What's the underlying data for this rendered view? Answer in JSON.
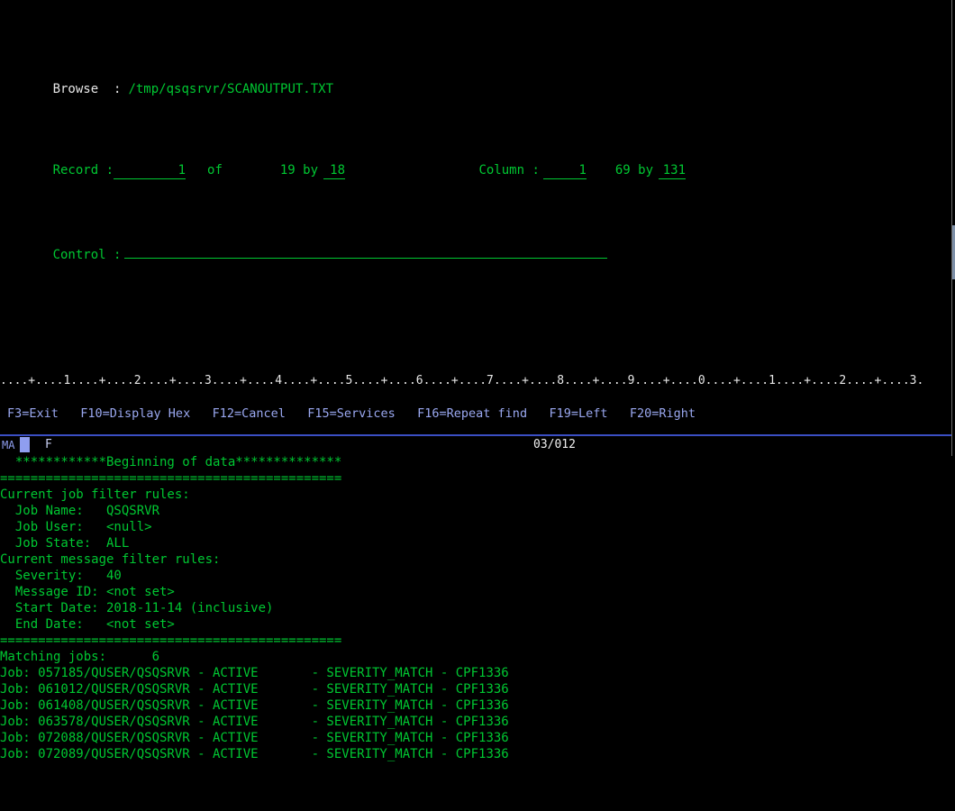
{
  "header": {
    "browse_label": "Browse  :",
    "file_path": "/tmp/qsqsrvr/SCANOUTPUT.TXT",
    "record_label": "Record :",
    "record_value": "      1",
    "record_of": "of",
    "record_total": "19 by",
    "record_by": "18",
    "column_label": "Column :",
    "column_value": "   1",
    "column_total": "69 by",
    "column_by": "131",
    "control_label": "Control :",
    "control_value": ""
  },
  "ruler": "....+....1....+....2....+....3....+....4....+....5....+....6....+....7....+....8....+....9....+....0....+....1....+....2....+....3.",
  "body_lines": [
    "  ************Beginning of data**************",
    "=============================================",
    "Current job filter rules:",
    "  Job Name:   QSQSRVR",
    "  Job User:   <null>",
    "  Job State:  ALL",
    "Current message filter rules:",
    "  Severity:   40",
    "  Message ID: <not set>",
    "  Start Date: 2018-11-14 (inclusive)",
    "  End Date:   <not set>",
    "=============================================",
    "Matching jobs:      6",
    "Job: 057185/QUSER/QSQSRVR - ACTIVE       - SEVERITY_MATCH - CPF1336",
    "Job: 061012/QUSER/QSQSRVR - ACTIVE       - SEVERITY_MATCH - CPF1336",
    "Job: 061408/QUSER/QSQSRVR - ACTIVE       - SEVERITY_MATCH - CPF1336",
    "Job: 063578/QUSER/QSQSRVR - ACTIVE       - SEVERITY_MATCH - CPF1336",
    "Job: 072088/QUSER/QSQSRVR - ACTIVE       - SEVERITY_MATCH - CPF1336",
    "Job: 072089/QUSER/QSQSRVR - ACTIVE       - SEVERITY_MATCH - CPF1336"
  ],
  "function_keys": "F3=Exit   F10=Display Hex   F12=Cancel   F15=Services   F16=Repeat find   F19=Left   F20=Right",
  "status_bar": {
    "ma_indicator": "MA",
    "input_mode": "F",
    "cursor_position": "03/012"
  },
  "colors": {
    "background": "#000000",
    "green_text": "#00c832",
    "white_text": "#e8e8e8",
    "function_key_text": "#9aa8f0",
    "status_accent": "#3b4fc4"
  }
}
